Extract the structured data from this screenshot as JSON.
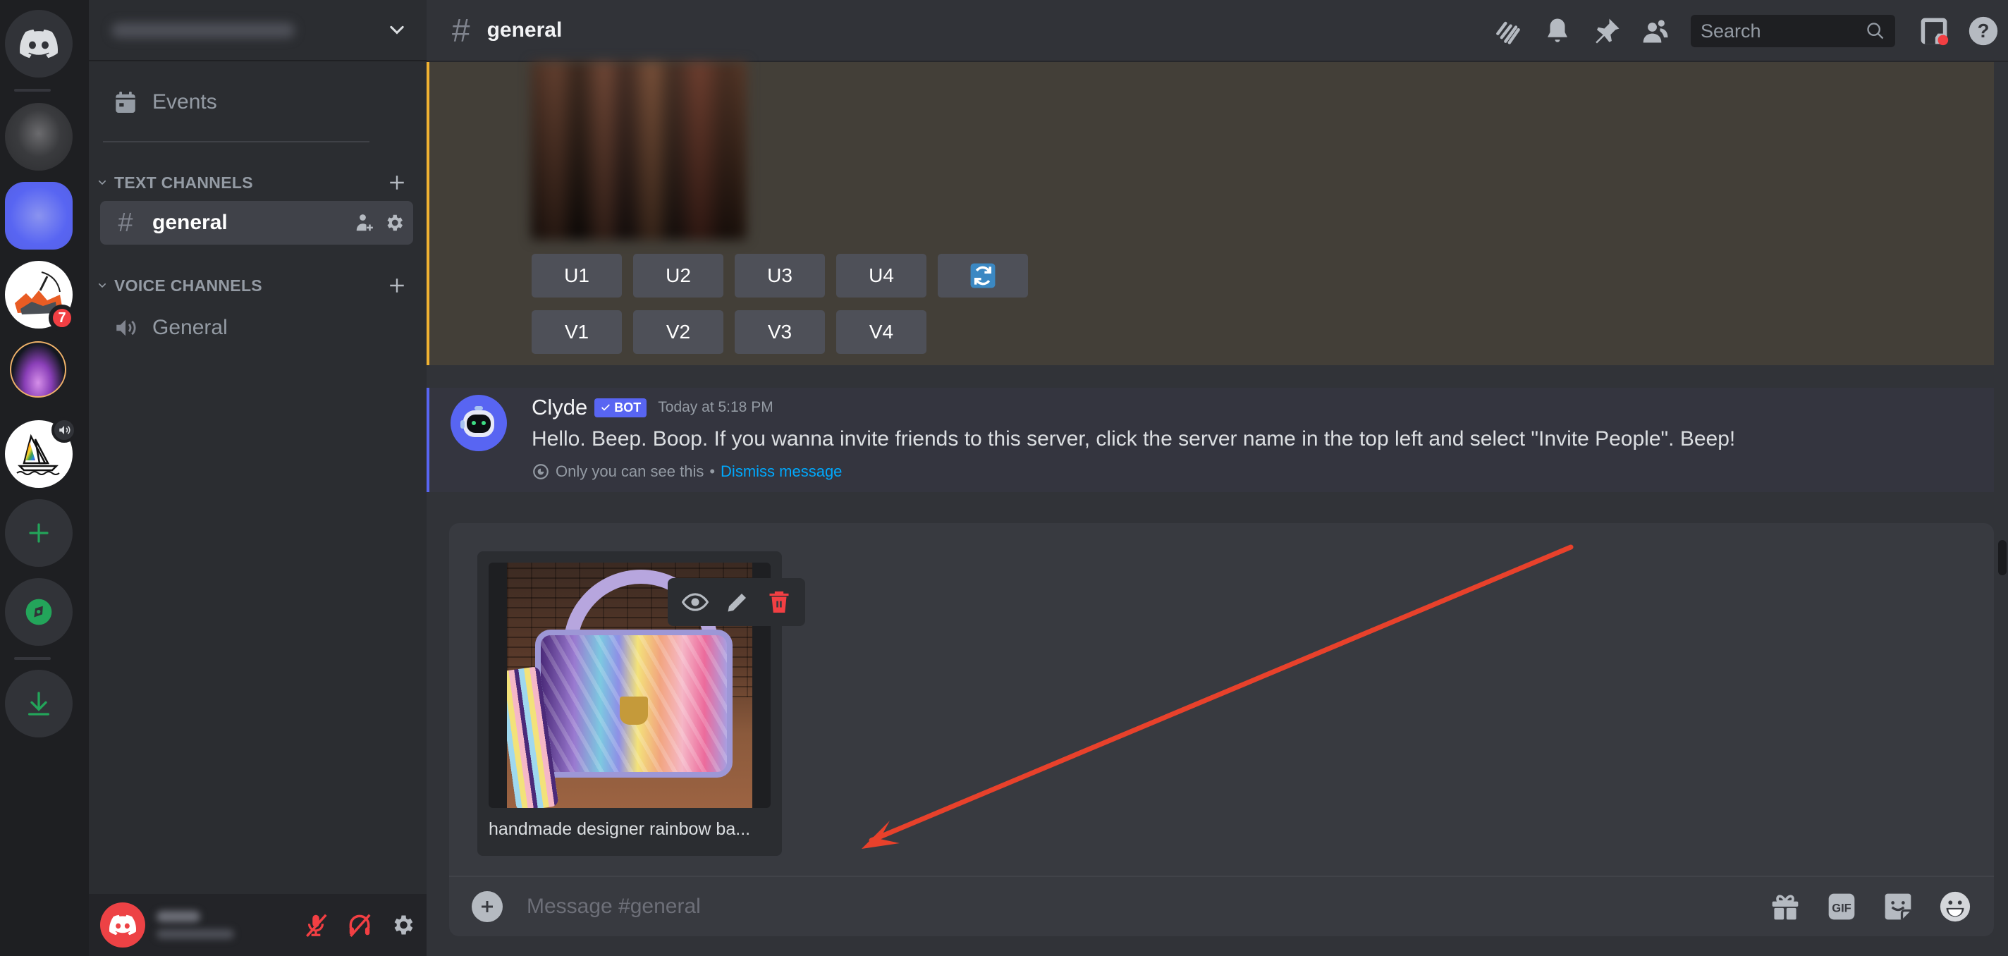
{
  "server_rail": {
    "items": [
      {
        "name": "Direct Messages",
        "type": "home"
      },
      {
        "name": "Blurred server",
        "type": "server"
      },
      {
        "name": "Blurred server (selected)",
        "type": "server"
      },
      {
        "name": "Painting server",
        "type": "server",
        "badge": "7"
      },
      {
        "name": "Purple server",
        "type": "server"
      },
      {
        "name": "Midjourney",
        "type": "server",
        "voice_active": true
      },
      {
        "name": "Add a Server",
        "type": "action"
      },
      {
        "name": "Explore Discoverable Servers",
        "type": "action"
      },
      {
        "name": "Download Apps",
        "type": "action"
      }
    ],
    "badge_count": "7"
  },
  "sidebar": {
    "server_name": "(blurred)",
    "events_label": "Events",
    "categories": [
      {
        "label": "TEXT CHANNELS",
        "channels": [
          {
            "name": "general",
            "active": true
          }
        ]
      },
      {
        "label": "VOICE CHANNELS",
        "channels": [
          {
            "name": "General",
            "active": false
          }
        ]
      }
    ],
    "user": {
      "name": "(blurred)",
      "status": "(blurred)",
      "mic_muted": true,
      "deafened": true
    }
  },
  "header": {
    "channel_name": "general",
    "search_placeholder": "Search"
  },
  "messages": {
    "midjourney": {
      "upscale_buttons": [
        "U1",
        "U2",
        "U3",
        "U4"
      ],
      "variation_buttons": [
        "V1",
        "V2",
        "V3",
        "V4"
      ],
      "reroll_icon": "reroll-icon"
    },
    "clyde": {
      "author": "Clyde",
      "bot_tag": "BOT",
      "timestamp": "Today at 5:18 PM",
      "text": "Hello. Beep. Boop. If you wanna invite friends to this server, click the server name in the top left and select \"Invite People\". Beep!",
      "ephemeral_note": "Only you can see this",
      "separator": "•",
      "dismiss_label": "Dismiss message"
    }
  },
  "composer": {
    "attachment": {
      "filename": "handmade designer rainbow ba..."
    },
    "placeholder": "Message #general"
  },
  "colors": {
    "blurple": "#5865f2",
    "highlight_yellow": "#f0b232",
    "danger_red": "#f23f43",
    "link_blue": "#00a8fc",
    "green": "#23a55a",
    "annotation_arrow": "#e8412b"
  }
}
